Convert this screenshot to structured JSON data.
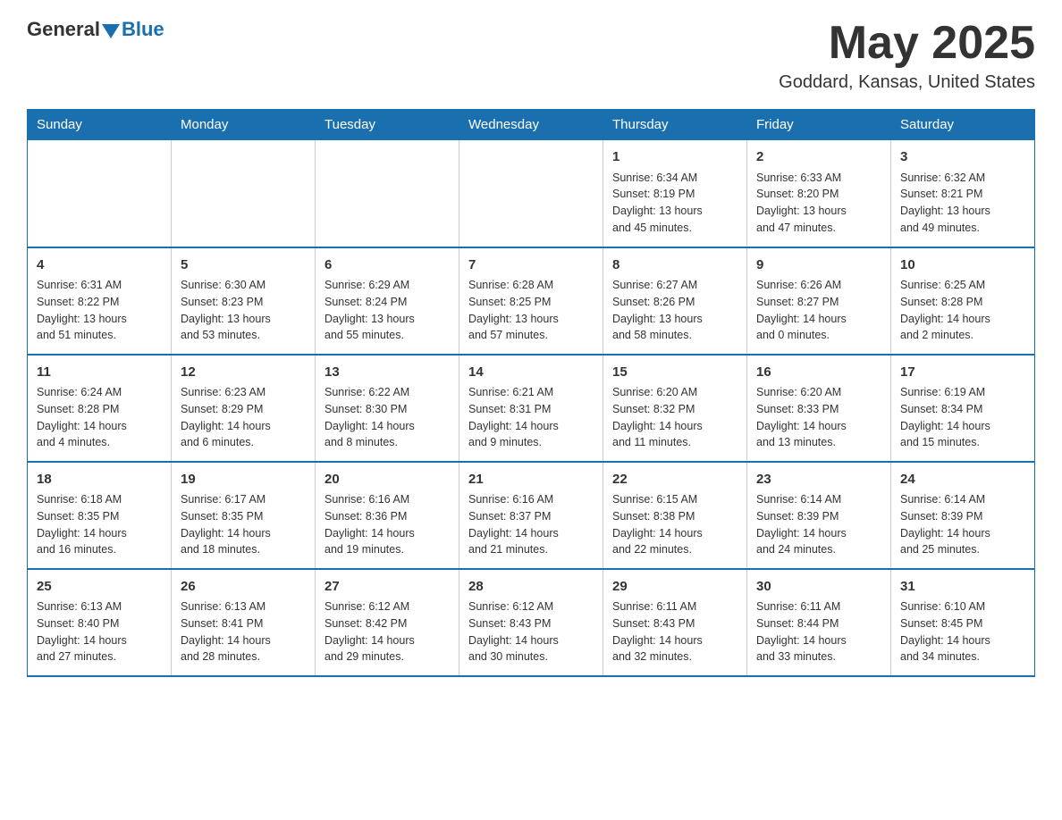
{
  "header": {
    "logo_general": "General",
    "logo_blue": "Blue",
    "main_title": "May 2025",
    "subtitle": "Goddard, Kansas, United States"
  },
  "days_of_week": [
    "Sunday",
    "Monday",
    "Tuesday",
    "Wednesday",
    "Thursday",
    "Friday",
    "Saturday"
  ],
  "weeks": [
    [
      {
        "day": "",
        "info": ""
      },
      {
        "day": "",
        "info": ""
      },
      {
        "day": "",
        "info": ""
      },
      {
        "day": "",
        "info": ""
      },
      {
        "day": "1",
        "info": "Sunrise: 6:34 AM\nSunset: 8:19 PM\nDaylight: 13 hours\nand 45 minutes."
      },
      {
        "day": "2",
        "info": "Sunrise: 6:33 AM\nSunset: 8:20 PM\nDaylight: 13 hours\nand 47 minutes."
      },
      {
        "day": "3",
        "info": "Sunrise: 6:32 AM\nSunset: 8:21 PM\nDaylight: 13 hours\nand 49 minutes."
      }
    ],
    [
      {
        "day": "4",
        "info": "Sunrise: 6:31 AM\nSunset: 8:22 PM\nDaylight: 13 hours\nand 51 minutes."
      },
      {
        "day": "5",
        "info": "Sunrise: 6:30 AM\nSunset: 8:23 PM\nDaylight: 13 hours\nand 53 minutes."
      },
      {
        "day": "6",
        "info": "Sunrise: 6:29 AM\nSunset: 8:24 PM\nDaylight: 13 hours\nand 55 minutes."
      },
      {
        "day": "7",
        "info": "Sunrise: 6:28 AM\nSunset: 8:25 PM\nDaylight: 13 hours\nand 57 minutes."
      },
      {
        "day": "8",
        "info": "Sunrise: 6:27 AM\nSunset: 8:26 PM\nDaylight: 13 hours\nand 58 minutes."
      },
      {
        "day": "9",
        "info": "Sunrise: 6:26 AM\nSunset: 8:27 PM\nDaylight: 14 hours\nand 0 minutes."
      },
      {
        "day": "10",
        "info": "Sunrise: 6:25 AM\nSunset: 8:28 PM\nDaylight: 14 hours\nand 2 minutes."
      }
    ],
    [
      {
        "day": "11",
        "info": "Sunrise: 6:24 AM\nSunset: 8:28 PM\nDaylight: 14 hours\nand 4 minutes."
      },
      {
        "day": "12",
        "info": "Sunrise: 6:23 AM\nSunset: 8:29 PM\nDaylight: 14 hours\nand 6 minutes."
      },
      {
        "day": "13",
        "info": "Sunrise: 6:22 AM\nSunset: 8:30 PM\nDaylight: 14 hours\nand 8 minutes."
      },
      {
        "day": "14",
        "info": "Sunrise: 6:21 AM\nSunset: 8:31 PM\nDaylight: 14 hours\nand 9 minutes."
      },
      {
        "day": "15",
        "info": "Sunrise: 6:20 AM\nSunset: 8:32 PM\nDaylight: 14 hours\nand 11 minutes."
      },
      {
        "day": "16",
        "info": "Sunrise: 6:20 AM\nSunset: 8:33 PM\nDaylight: 14 hours\nand 13 minutes."
      },
      {
        "day": "17",
        "info": "Sunrise: 6:19 AM\nSunset: 8:34 PM\nDaylight: 14 hours\nand 15 minutes."
      }
    ],
    [
      {
        "day": "18",
        "info": "Sunrise: 6:18 AM\nSunset: 8:35 PM\nDaylight: 14 hours\nand 16 minutes."
      },
      {
        "day": "19",
        "info": "Sunrise: 6:17 AM\nSunset: 8:35 PM\nDaylight: 14 hours\nand 18 minutes."
      },
      {
        "day": "20",
        "info": "Sunrise: 6:16 AM\nSunset: 8:36 PM\nDaylight: 14 hours\nand 19 minutes."
      },
      {
        "day": "21",
        "info": "Sunrise: 6:16 AM\nSunset: 8:37 PM\nDaylight: 14 hours\nand 21 minutes."
      },
      {
        "day": "22",
        "info": "Sunrise: 6:15 AM\nSunset: 8:38 PM\nDaylight: 14 hours\nand 22 minutes."
      },
      {
        "day": "23",
        "info": "Sunrise: 6:14 AM\nSunset: 8:39 PM\nDaylight: 14 hours\nand 24 minutes."
      },
      {
        "day": "24",
        "info": "Sunrise: 6:14 AM\nSunset: 8:39 PM\nDaylight: 14 hours\nand 25 minutes."
      }
    ],
    [
      {
        "day": "25",
        "info": "Sunrise: 6:13 AM\nSunset: 8:40 PM\nDaylight: 14 hours\nand 27 minutes."
      },
      {
        "day": "26",
        "info": "Sunrise: 6:13 AM\nSunset: 8:41 PM\nDaylight: 14 hours\nand 28 minutes."
      },
      {
        "day": "27",
        "info": "Sunrise: 6:12 AM\nSunset: 8:42 PM\nDaylight: 14 hours\nand 29 minutes."
      },
      {
        "day": "28",
        "info": "Sunrise: 6:12 AM\nSunset: 8:43 PM\nDaylight: 14 hours\nand 30 minutes."
      },
      {
        "day": "29",
        "info": "Sunrise: 6:11 AM\nSunset: 8:43 PM\nDaylight: 14 hours\nand 32 minutes."
      },
      {
        "day": "30",
        "info": "Sunrise: 6:11 AM\nSunset: 8:44 PM\nDaylight: 14 hours\nand 33 minutes."
      },
      {
        "day": "31",
        "info": "Sunrise: 6:10 AM\nSunset: 8:45 PM\nDaylight: 14 hours\nand 34 minutes."
      }
    ]
  ]
}
